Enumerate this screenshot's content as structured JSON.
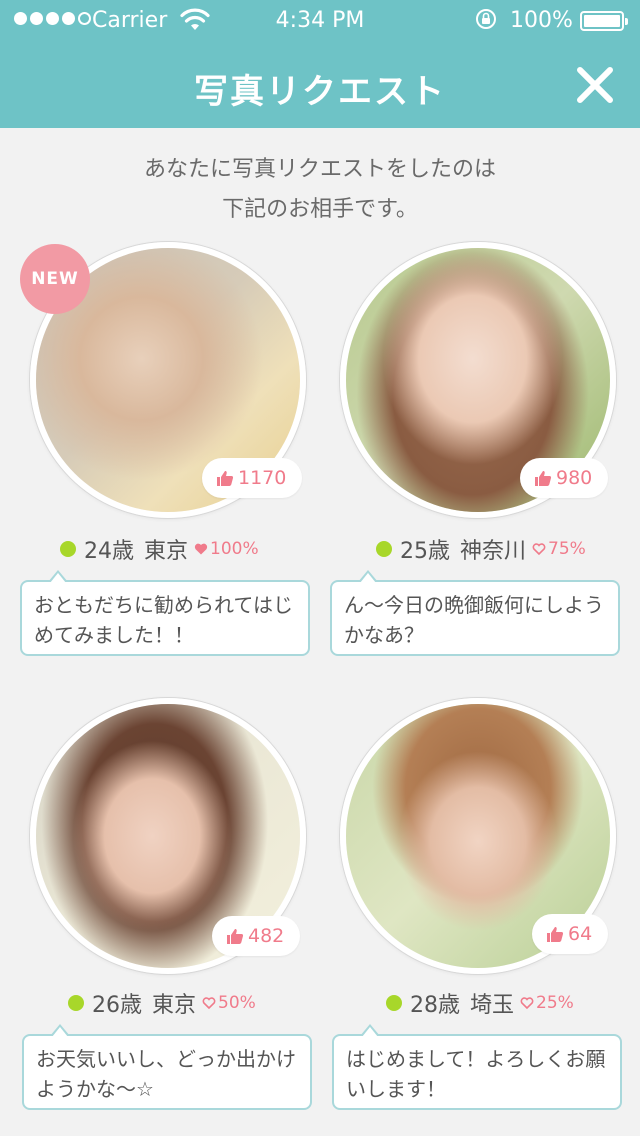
{
  "status_bar": {
    "carrier": "Carrier",
    "time": "4:34 PM",
    "battery": "100%",
    "signal_bars": 4
  },
  "nav": {
    "title": "写真リクエスト",
    "close_icon": "close-icon"
  },
  "intro": {
    "line1": "あなたに写真リクエストをしたのは",
    "line2": "下記のお相手です。"
  },
  "colors": {
    "header": "#6ec3c6",
    "accent_pink": "#f07b8b",
    "new_badge": "#f29aa4",
    "online_dot": "#a8d72a",
    "bubble_border": "#a9d8db"
  },
  "profiles": [
    {
      "badge": "NEW",
      "likes": "1170",
      "age": "24歳",
      "area": "東京",
      "rate": "100%",
      "rate_heart": "filled",
      "message": "おともだちに勧められてはじめてみました！！"
    },
    {
      "badge": "",
      "likes": "980",
      "age": "25歳",
      "area": "神奈川",
      "rate": "75%",
      "rate_heart": "outline",
      "message": "ん〜今日の晩御飯何にしようかなあ？"
    },
    {
      "badge": "",
      "likes": "482",
      "age": "26歳",
      "area": "東京",
      "rate": "50%",
      "rate_heart": "outline",
      "message": "お天気いいし、どっか出かけようかな〜☆"
    },
    {
      "badge": "",
      "likes": "64",
      "age": "28歳",
      "area": "埼玉",
      "rate": "25%",
      "rate_heart": "outline",
      "message": "はじめまして！よろしくお願いします！"
    }
  ]
}
